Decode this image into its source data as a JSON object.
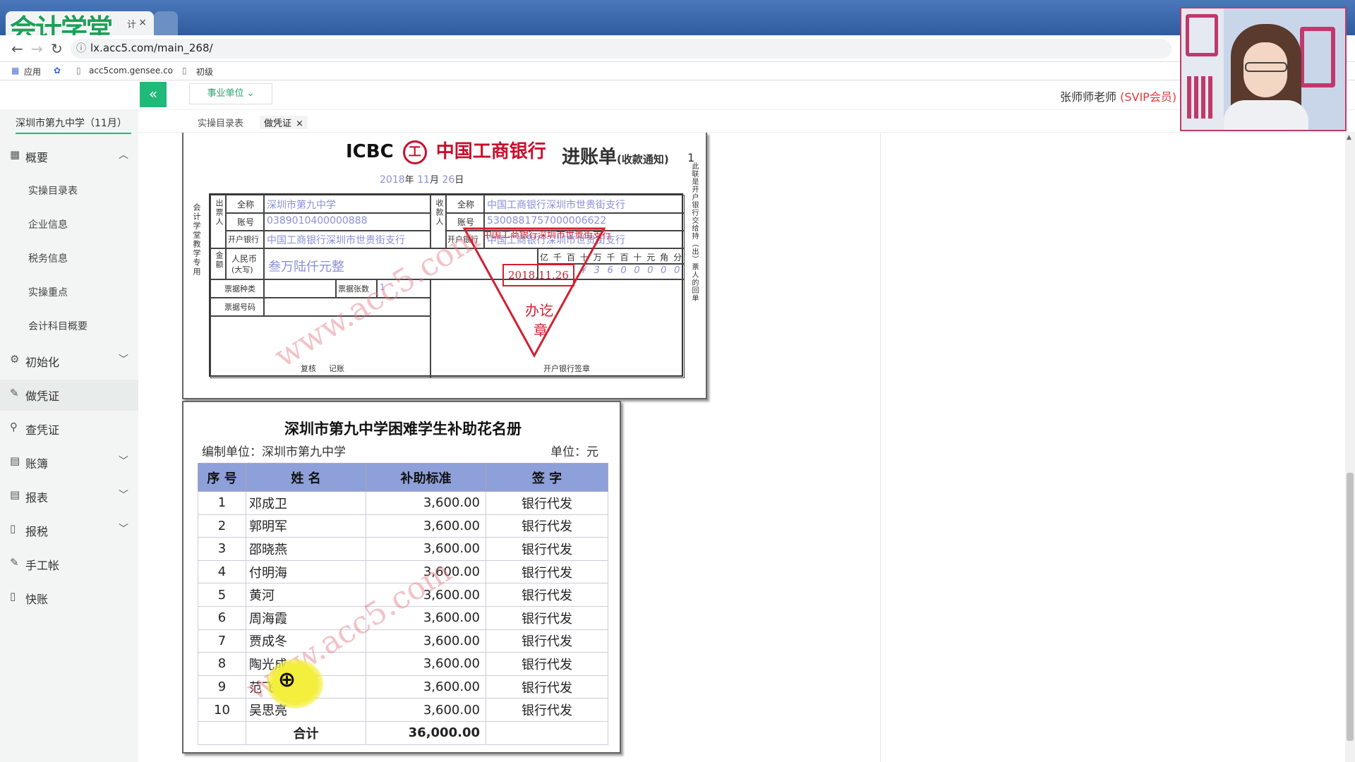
{
  "browser": {
    "brand_logo": "会计学堂",
    "tab_fragment": "计",
    "tab_close": "×",
    "url": "lx.acc5.com/main_268/",
    "bookmarks": [
      {
        "label": "应用",
        "icon": "apps-grid-icon"
      },
      {
        "label": "",
        "icon": "baidu-paw-icon"
      },
      {
        "label": "acc5com.gensee.co",
        "icon": "page-icon"
      },
      {
        "label": "初级",
        "icon": "page-icon"
      }
    ]
  },
  "header": {
    "collapse_glyph": "«",
    "unit_select": "事业单位 ⌄",
    "user_name": "张师师老师",
    "user_badge": "(SVIP会员)"
  },
  "sidebar": {
    "school": "深圳市第九中学（11月）",
    "sections": [
      {
        "label": "概要",
        "icon": "grid-icon",
        "chevron": "︿"
      },
      {
        "label": "初始化",
        "icon": "gear-icon",
        "chevron": "﹀"
      },
      {
        "label": "做凭证",
        "icon": "pen-icon",
        "chevron": ""
      },
      {
        "label": "查凭证",
        "icon": "search-icon",
        "chevron": ""
      },
      {
        "label": "账簿",
        "icon": "book-icon",
        "chevron": "﹀"
      },
      {
        "label": "报表",
        "icon": "report-icon",
        "chevron": "﹀"
      },
      {
        "label": "报税",
        "icon": "file-icon",
        "chevron": "﹀"
      },
      {
        "label": "手工帐",
        "icon": "pen-icon",
        "chevron": ""
      },
      {
        "label": "快账",
        "icon": "file-icon",
        "chevron": ""
      }
    ],
    "sub_items": [
      "实操目录表",
      "企业信息",
      "税务信息",
      "实操重点",
      "会计科目概要"
    ]
  },
  "content_tabs": [
    {
      "label": "实操目录表",
      "close": ""
    },
    {
      "label": "做凭证",
      "close": "×"
    }
  ],
  "slip": {
    "bank_prefix": "ICBC",
    "bank_name": "中国工商银行",
    "title": "进账单",
    "title_note": "(收款通知)",
    "copy_no": "1",
    "date_year": "2018",
    "date_year_unit": "年",
    "date_month": "11",
    "date_month_unit": "月",
    "date_day": "26",
    "date_day_unit": "日",
    "left_vertical": "会计学堂教学专用",
    "right_vertical": "此联是开户银行交给持（出）票人的回单",
    "payer_label": "出票人",
    "payee_label": "收款人",
    "amount_label": "金额",
    "full_name_label": "全称",
    "account_label": "账号",
    "bank_label": "开户银行",
    "payer_name": "深圳市第九中学",
    "payer_account": "0389010400000888",
    "payer_bank": "中国工商银行深圳市世贵街支行",
    "payee_name": "中国工商银行深圳市世贵街支行",
    "payee_account": "5300881757000006622",
    "payee_bank": "中国工商银行深圳市世贵街支行",
    "rmb_label": "人民币",
    "rmb_sub": "(大写)",
    "amount_words": "叁万陆仟元整",
    "digit_headers": [
      "亿",
      "千",
      "百",
      "十",
      "万",
      "千",
      "百",
      "十",
      "元",
      "角",
      "分"
    ],
    "digit_values": [
      "",
      "",
      "",
      "",
      "¥",
      "3",
      "6",
      "0",
      "0",
      "0",
      "0",
      "0"
    ],
    "bill_type_label": "票据种类",
    "bill_count_label": "票据张数",
    "bill_count": "1",
    "bill_no_label": "票据号码",
    "review_label": "复核",
    "record_label": "记账",
    "bank_seal_label": "开户银行签章",
    "stamp_date": "2018.11.26",
    "stamp_text1": "办讫",
    "stamp_text2": "章",
    "stamp_top": "中国工商银行深圳市世贵街支行"
  },
  "roster": {
    "title": "深圳市第九中学困难学生补助花名册",
    "org_label": "编制单位：深圳市第九中学",
    "unit_label": "单位：元",
    "headers": [
      "序  号",
      "姓    名",
      "补助标准",
      "签    字"
    ],
    "rows": [
      [
        "1",
        "邓成卫",
        "3,600.00",
        "银行代发"
      ],
      [
        "2",
        "郭明军",
        "3,600.00",
        "银行代发"
      ],
      [
        "3",
        "邵晓燕",
        "3,600.00",
        "银行代发"
      ],
      [
        "4",
        "付明海",
        "3,600.00",
        "银行代发"
      ],
      [
        "5",
        "黄河",
        "3,600.00",
        "银行代发"
      ],
      [
        "6",
        "周海霞",
        "3,600.00",
        "银行代发"
      ],
      [
        "7",
        "贾成冬",
        "3,600.00",
        "银行代发"
      ],
      [
        "8",
        "陶光成",
        "3,600.00",
        "银行代发"
      ],
      [
        "9",
        "范飞",
        "3,600.00",
        "银行代发"
      ],
      [
        "10",
        "吴思亮",
        "3,600.00",
        "银行代发"
      ]
    ],
    "total_label": "合计",
    "total_value": "36,000.00"
  },
  "watermark": "www.acc5.com",
  "colors": {
    "accent": "#1fb97a",
    "vip": "#e03b3b",
    "stamp": "#d02030",
    "table_header": "#8ea0d9"
  }
}
